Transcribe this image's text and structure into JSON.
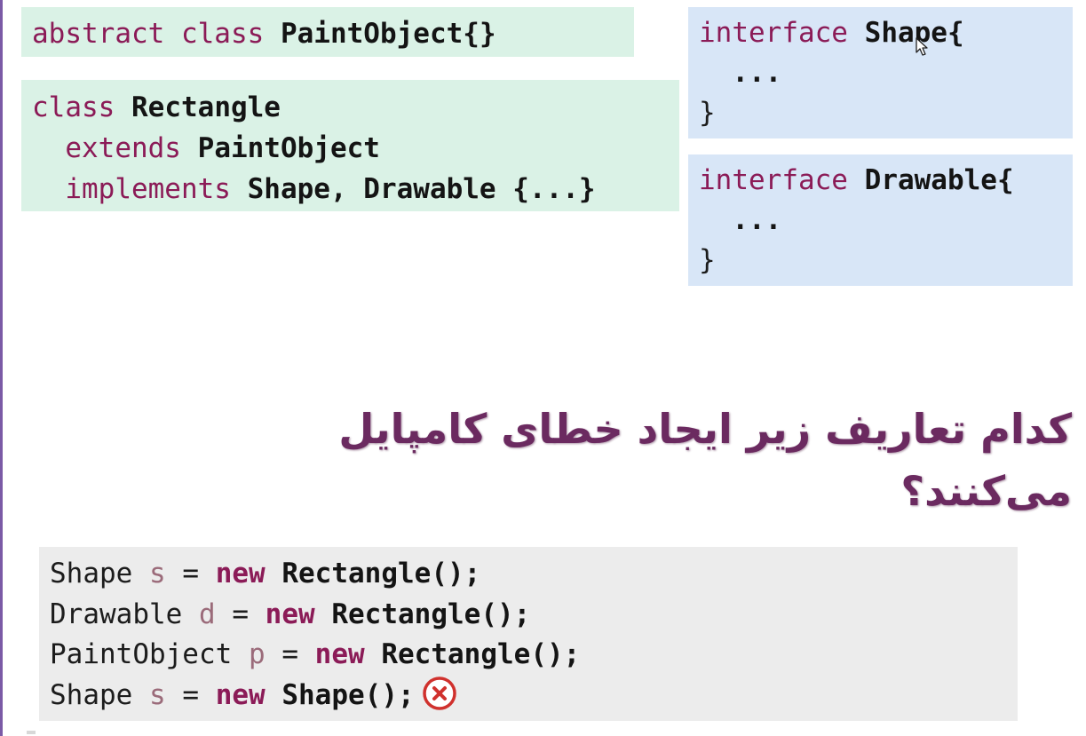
{
  "code_boxes": {
    "paint_object": {
      "line1": {
        "kw1": "abstract",
        "kw2": "class",
        "name": "PaintObject{}"
      }
    },
    "rectangle": {
      "line1": {
        "kw": "class",
        "name": "Rectangle"
      },
      "line2": {
        "kw": "extends",
        "name": "PaintObject"
      },
      "line3": {
        "kw": "implements",
        "name": "Shape, Drawable {...}"
      }
    },
    "shape_interface": {
      "line1": {
        "kw": "interface",
        "name": "Shape{"
      },
      "line2": "...",
      "line3": "}"
    },
    "drawable_interface": {
      "line1": {
        "kw": "interface",
        "name": "Drawable{"
      },
      "line2": "...",
      "line3": "}"
    }
  },
  "question": "کدام تعاریف زیر ایجاد خطای کامپایل می‌کنند؟",
  "examples": [
    {
      "type": "Shape",
      "var": "s",
      "op": "=",
      "kw": "new",
      "expr": "Rectangle();",
      "error": false
    },
    {
      "type": "Drawable",
      "var": "d",
      "op": "=",
      "kw": "new",
      "expr": "Rectangle();",
      "error": false
    },
    {
      "type": "PaintObject",
      "var": "p",
      "op": "=",
      "kw": "new",
      "expr": "Rectangle();",
      "error": false
    },
    {
      "type": "Shape",
      "var": "s",
      "op": "=",
      "kw": "new",
      "expr": "Shape();",
      "error": true
    }
  ],
  "colors": {
    "keyword": "#8b1b57",
    "question": "#6b2a60",
    "green_box": "#daf2e6",
    "blue_box": "#d8e6f7",
    "gray_box": "#ececec",
    "error_icon": "#d0312d"
  },
  "icons": {
    "error": "x-circle-icon",
    "cursor": "mouse-cursor-icon"
  }
}
